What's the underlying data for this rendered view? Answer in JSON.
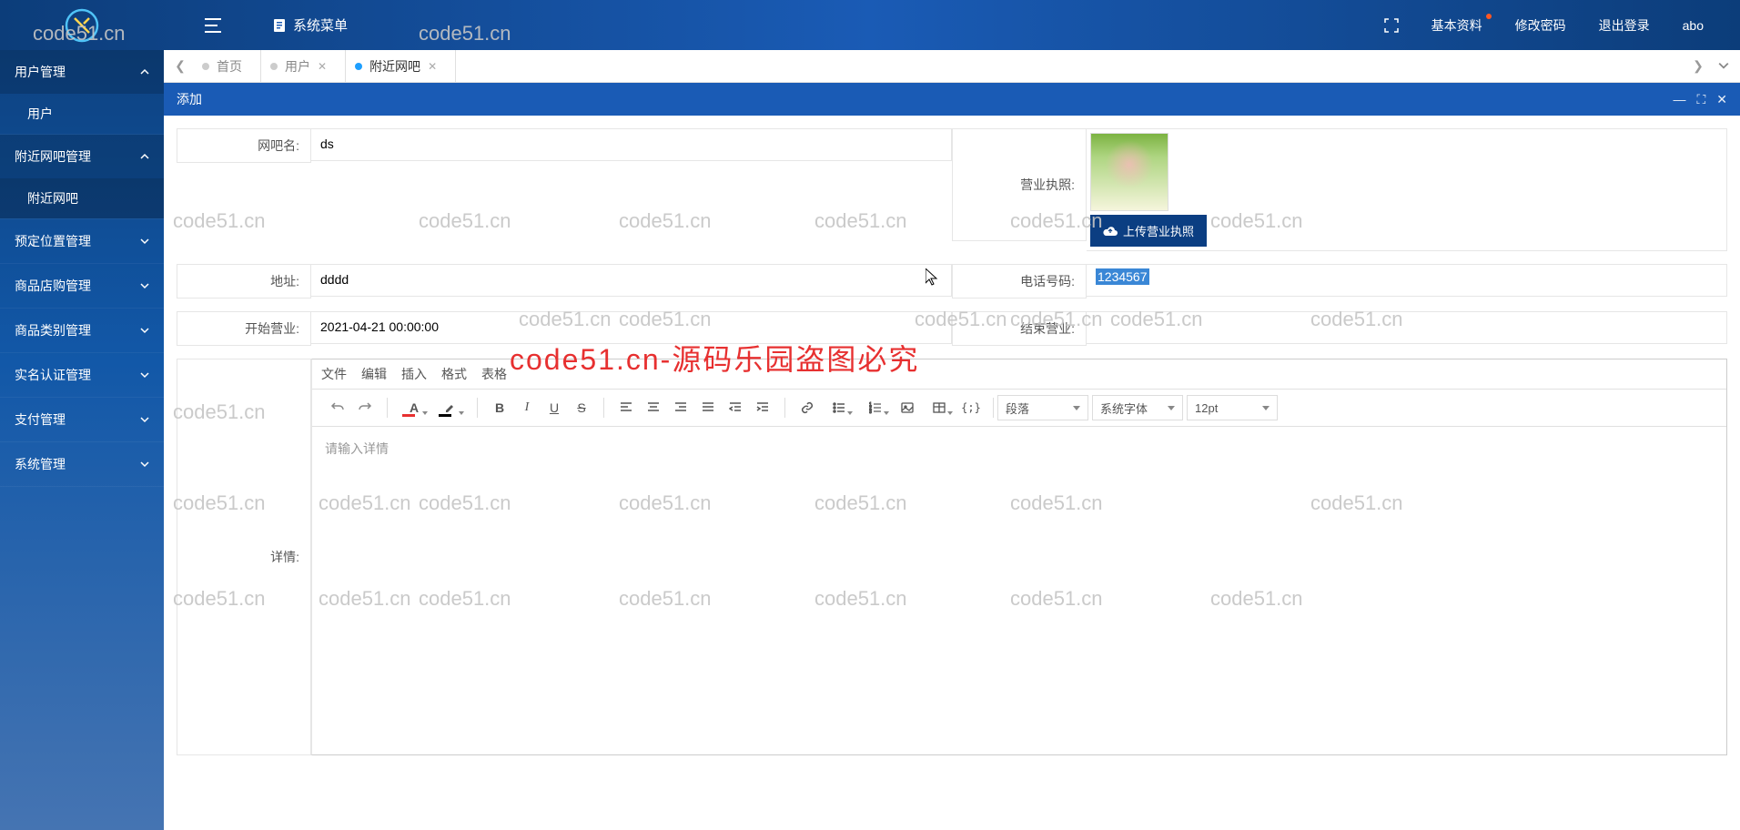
{
  "header": {
    "sys_menu": "系统菜单",
    "basic_info": "基本资料",
    "change_pwd": "修改密码",
    "logout": "退出登录",
    "username": "abo"
  },
  "sidebar": {
    "groups": [
      {
        "title": "用户管理",
        "expanded": true,
        "items": [
          "用户"
        ]
      },
      {
        "title": "附近网吧管理",
        "expanded": true,
        "items": [
          "附近网吧"
        ],
        "selected": 0
      },
      {
        "title": "预定位置管理",
        "expanded": false
      },
      {
        "title": "商品店购管理",
        "expanded": false
      },
      {
        "title": "商品类别管理",
        "expanded": false
      },
      {
        "title": "实名认证管理",
        "expanded": false
      },
      {
        "title": "支付管理",
        "expanded": false
      },
      {
        "title": "系统管理",
        "expanded": false
      }
    ]
  },
  "tabs": {
    "items": [
      {
        "label": "首页",
        "closable": false
      },
      {
        "label": "用户",
        "closable": true
      },
      {
        "label": "附近网吧",
        "closable": true,
        "active": true
      }
    ]
  },
  "panel": {
    "title": "添加"
  },
  "form": {
    "name_label": "网吧名:",
    "name_value": "ds",
    "license_label": "营业执照:",
    "upload_label": "上传营业执照",
    "address_label": "地址:",
    "address_value": "dddd",
    "phone_label": "电话号码:",
    "phone_value": "1234567",
    "start_label": "开始营业:",
    "start_value": "2021-04-21 00:00:00",
    "end_label": "结束营业:",
    "end_value": "",
    "detail_label": "详情:",
    "detail_placeholder": "请输入详情"
  },
  "editor": {
    "menu": {
      "file": "文件",
      "edit": "编辑",
      "insert": "插入",
      "format": "格式",
      "table": "表格"
    },
    "paragraph": "段落",
    "font": "系统字体",
    "size": "12pt"
  },
  "watermark": {
    "repeat": "code51.cn",
    "banner": "code51.cn-源码乐园盗图必究"
  }
}
